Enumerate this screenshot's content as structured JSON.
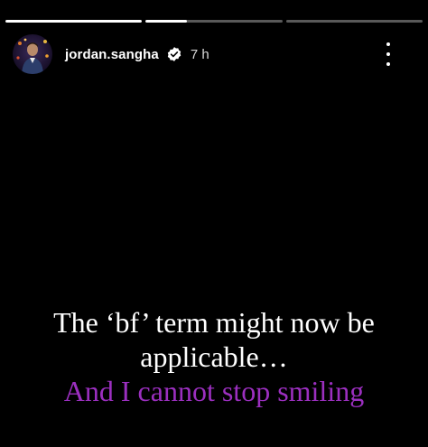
{
  "story": {
    "progress": [
      {
        "fill": 1.0
      },
      {
        "fill": 0.3
      },
      {
        "fill": 0.0
      }
    ],
    "header": {
      "username": "jordan.sangha",
      "time": "7 h",
      "avatar_icon": "avatar-photo",
      "verified_icon": "verified-badge-icon",
      "more_icon": "more-vertical-icon"
    },
    "caption": {
      "line1": "The ‘bf’ term might now be",
      "line2": "applicable…",
      "line3": "And I cannot stop smiling"
    },
    "colors": {
      "background": "#000000",
      "caption_primary": "#ffffff",
      "caption_accent": "#9b2fbf"
    }
  }
}
